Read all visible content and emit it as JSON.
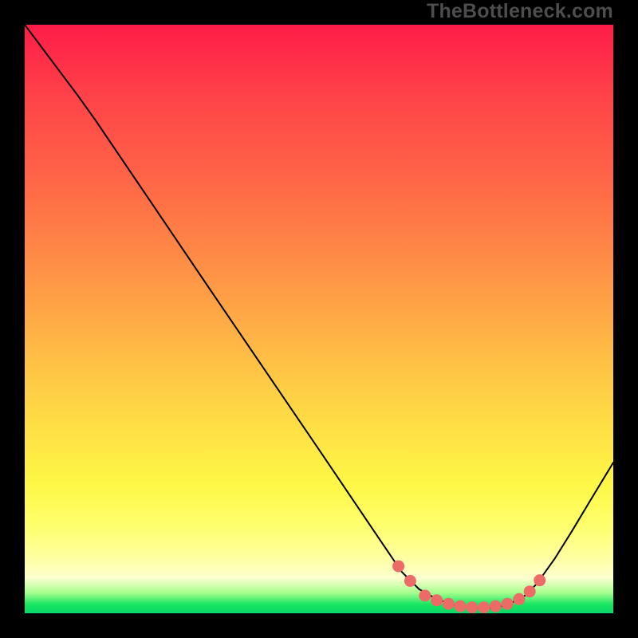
{
  "watermark": "TheBottleneck.com",
  "colors": {
    "background": "#000000",
    "curve_stroke": "#000000",
    "dot_fill": "#ec6b66",
    "watermark": "#4d4d4d"
  },
  "gradient_stops": [
    {
      "offset": 0.0,
      "color": "#ff1c47"
    },
    {
      "offset": 0.12,
      "color": "#ff4249"
    },
    {
      "offset": 0.25,
      "color": "#ff6247"
    },
    {
      "offset": 0.38,
      "color": "#ff8646"
    },
    {
      "offset": 0.5,
      "color": "#ffaa46"
    },
    {
      "offset": 0.62,
      "color": "#ffce45"
    },
    {
      "offset": 0.7,
      "color": "#ffe345"
    },
    {
      "offset": 0.78,
      "color": "#fef746"
    },
    {
      "offset": 0.85,
      "color": "#feff6b"
    },
    {
      "offset": 0.905,
      "color": "#feffa0"
    },
    {
      "offset": 0.94,
      "color": "#fdffce"
    },
    {
      "offset": 0.965,
      "color": "#a7ff8f"
    },
    {
      "offset": 0.985,
      "color": "#17e660"
    },
    {
      "offset": 1.0,
      "color": "#0bd767"
    }
  ],
  "chart_data": {
    "type": "line",
    "title": "",
    "xlabel": "",
    "ylabel": "",
    "xlim": [
      0,
      1
    ],
    "ylim": [
      0,
      1
    ],
    "series": [
      {
        "name": "bottleneck-curve",
        "x": [
          0.0,
          0.03,
          0.06,
          0.09,
          0.12,
          0.2,
          0.3,
          0.4,
          0.5,
          0.6,
          0.64,
          0.67,
          0.7,
          0.73,
          0.76,
          0.79,
          0.82,
          0.85,
          0.87,
          0.9,
          0.93,
          0.96,
          1.0
        ],
        "y": [
          1.0,
          0.96,
          0.92,
          0.88,
          0.838,
          0.72,
          0.572,
          0.425,
          0.278,
          0.13,
          0.071,
          0.041,
          0.024,
          0.014,
          0.009,
          0.009,
          0.014,
          0.03,
          0.05,
          0.092,
          0.14,
          0.19,
          0.256
        ]
      }
    ],
    "highlight_points": {
      "name": "valley-dots",
      "x": [
        0.635,
        0.655,
        0.68,
        0.7,
        0.72,
        0.74,
        0.76,
        0.78,
        0.8,
        0.82,
        0.84,
        0.858,
        0.875
      ],
      "y": [
        0.08,
        0.055,
        0.03,
        0.022,
        0.016,
        0.012,
        0.01,
        0.01,
        0.012,
        0.016,
        0.024,
        0.037,
        0.056
      ]
    }
  }
}
